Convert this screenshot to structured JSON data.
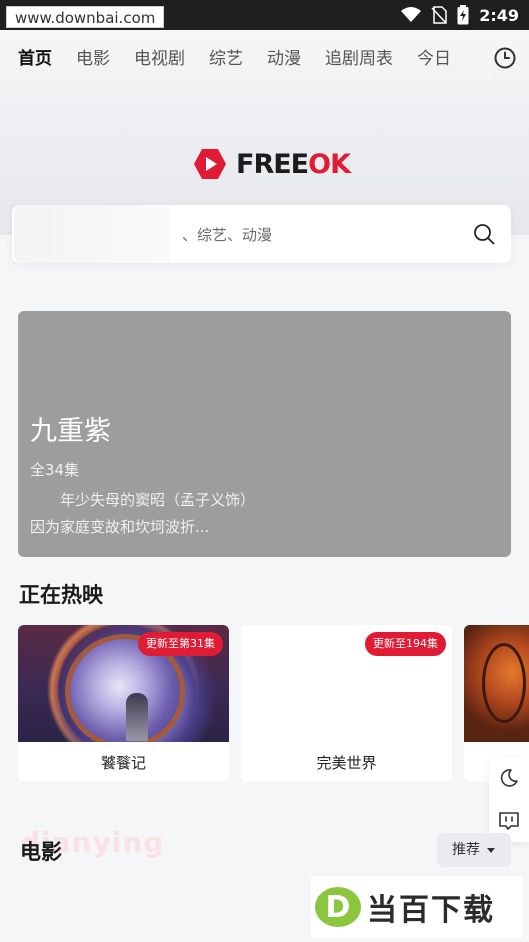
{
  "status_bar": {
    "watermark": "www.downbai.com",
    "time": "2:49"
  },
  "tabs": [
    "首页",
    "电影",
    "电视剧",
    "综艺",
    "动漫",
    "追剧周表",
    "今日"
  ],
  "logo": {
    "part1": "FREE",
    "part2": "OK"
  },
  "search": {
    "placeholder_visible": "、综艺、动漫"
  },
  "banner": {
    "title": "九重紫",
    "episodes": "全34集",
    "description": "年少失母的窦昭（孟子义饰）因为家庭变故和坎坷波折..."
  },
  "now_showing": {
    "title": "正在热映",
    "cards": [
      {
        "name": "饕餮记",
        "badge": "更新至第31集"
      },
      {
        "name": "完美世界",
        "badge": "更新至194集"
      },
      {
        "name": "",
        "badge": ""
      }
    ]
  },
  "movies": {
    "ghost_text": "dianying",
    "title": "电影",
    "sort_label": "推荐"
  },
  "watermark_bottom": {
    "letter": "D",
    "text": "当百下载"
  },
  "colors": {
    "accent": "#e01b34",
    "tab_highlight": "#ffd34d",
    "banner_bg": "#9c9d9c"
  }
}
